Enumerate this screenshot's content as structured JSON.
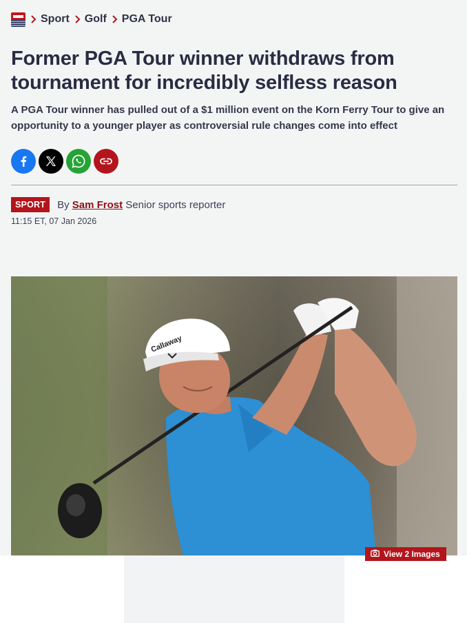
{
  "breadcrumb": {
    "logo_icon": "publication-logo-icon",
    "items": [
      "Sport",
      "Golf",
      "PGA Tour"
    ]
  },
  "article": {
    "title": "Former PGA Tour winner withdraws from tournament for incredibly selfless reason",
    "standfirst": "A PGA Tour winner has pulled out of a $1 million event on the Korn Ferry Tour to give an opportunity to a younger player as controversial rule changes come into effect",
    "section_tag": "SPORT",
    "byline_prefix": "By",
    "author": "Sam Frost",
    "author_role": "Senior sports reporter",
    "timestamp": "11:15 ET, 07 Jan 2026"
  },
  "share": {
    "buttons": [
      {
        "icon": "facebook-icon",
        "color": "#1877f2"
      },
      {
        "icon": "x-icon",
        "color": "#000000"
      },
      {
        "icon": "whatsapp-icon",
        "color": "#25a336"
      },
      {
        "icon": "link-icon",
        "color": "#b3151c"
      }
    ]
  },
  "hero": {
    "gallery_label": "View 2 Images",
    "camera_icon": "camera-icon"
  },
  "colors": {
    "accent": "#b3151c",
    "text": "#2a2c43",
    "background": "#f3f5f5"
  }
}
